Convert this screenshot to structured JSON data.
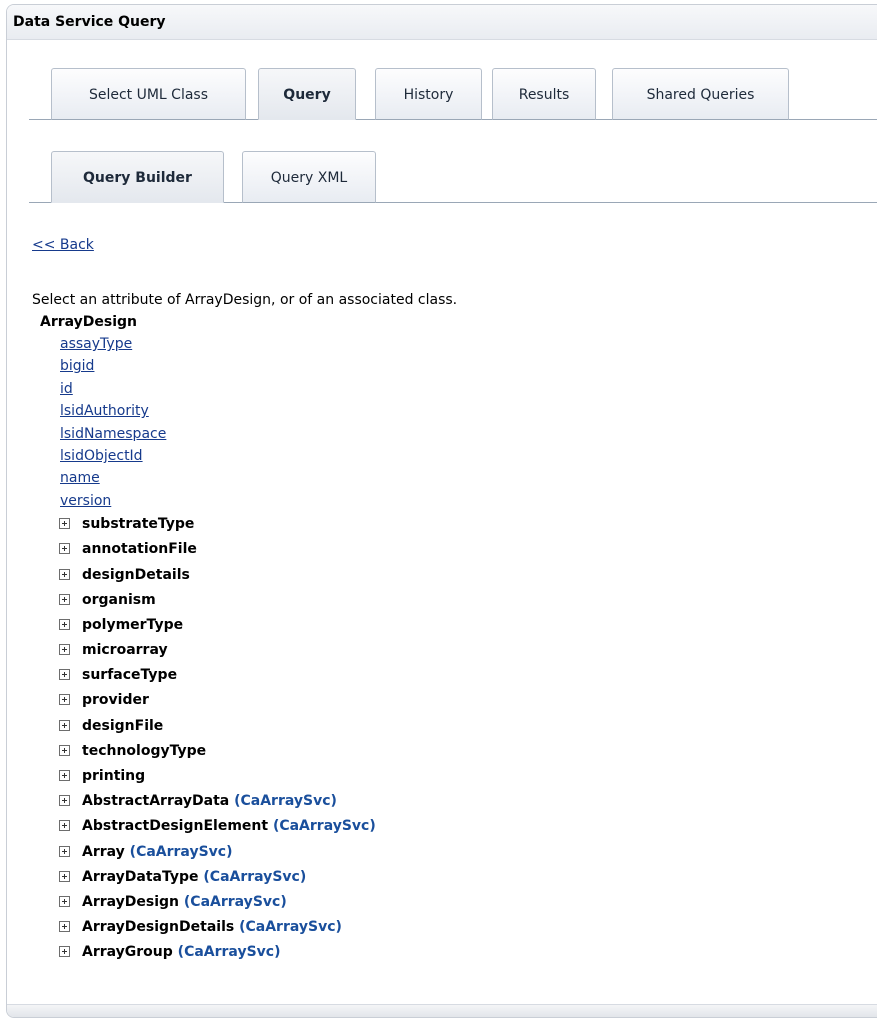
{
  "window": {
    "title": "Data Service Query"
  },
  "tabs": [
    {
      "label": "Select UML Class"
    },
    {
      "label": "Query",
      "active": true
    },
    {
      "label": "History"
    },
    {
      "label": "Results"
    },
    {
      "label": "Shared Queries"
    }
  ],
  "subtabs": [
    {
      "label": "Query Builder",
      "active": true
    },
    {
      "label": "Query XML"
    }
  ],
  "back_link": "<< Back",
  "instruction": "Select an attribute of ArrayDesign, or of an associated class.",
  "root_class": "ArrayDesign",
  "attributes": [
    "assayType",
    "bigid",
    "id",
    "lsidAuthority",
    "lsidNamespace",
    "lsidObjectId",
    "name",
    "version"
  ],
  "associations": [
    {
      "name": "substrateType",
      "service": ""
    },
    {
      "name": "annotationFile",
      "service": ""
    },
    {
      "name": "designDetails",
      "service": ""
    },
    {
      "name": "organism",
      "service": ""
    },
    {
      "name": "polymerType",
      "service": ""
    },
    {
      "name": "microarray",
      "service": ""
    },
    {
      "name": "surfaceType",
      "service": ""
    },
    {
      "name": "provider",
      "service": ""
    },
    {
      "name": "designFile",
      "service": ""
    },
    {
      "name": "technologyType",
      "service": ""
    },
    {
      "name": "printing",
      "service": ""
    },
    {
      "name": "AbstractArrayData",
      "service": "(CaArraySvc)"
    },
    {
      "name": "AbstractDesignElement",
      "service": "(CaArraySvc)"
    },
    {
      "name": "Array",
      "service": "(CaArraySvc)"
    },
    {
      "name": "ArrayDataType",
      "service": "(CaArraySvc)"
    },
    {
      "name": "ArrayDesign",
      "service": "(CaArraySvc)"
    },
    {
      "name": "ArrayDesignDetails",
      "service": "(CaArraySvc)"
    },
    {
      "name": "ArrayGroup",
      "service": "(CaArraySvc)"
    }
  ]
}
